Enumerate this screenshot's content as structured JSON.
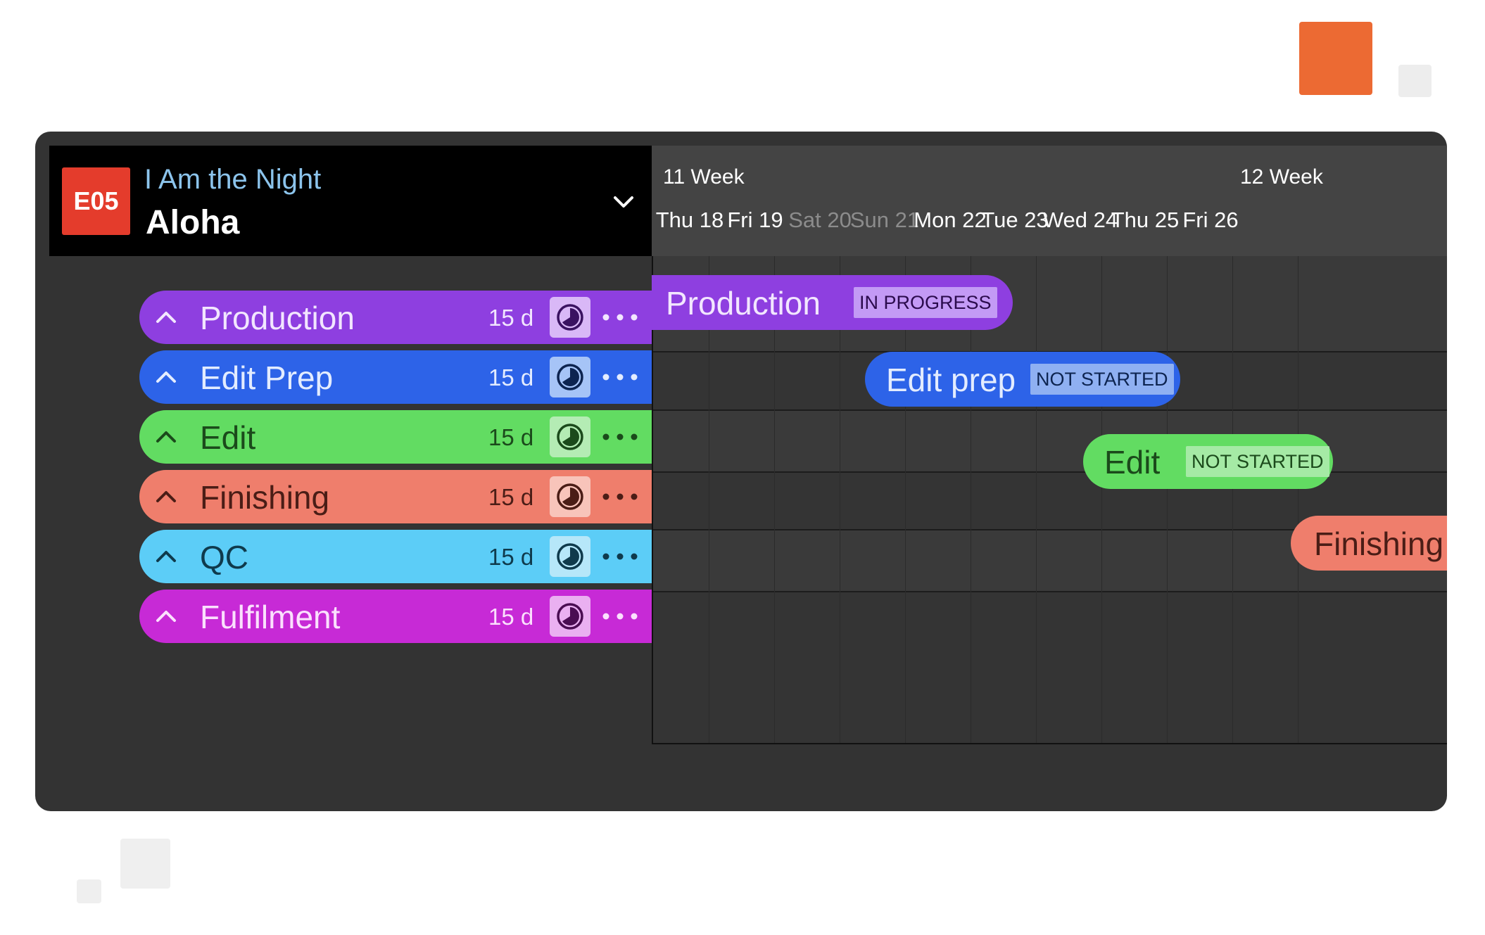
{
  "project": {
    "episode_code": "E05",
    "title": "I Am the Night",
    "episode_title": "Aloha"
  },
  "timeline": {
    "weeks": [
      {
        "label": "11 Week"
      },
      {
        "label": "12 Week"
      }
    ],
    "days": [
      {
        "label": "Thu 18",
        "weekend": false
      },
      {
        "label": "Fri 19",
        "weekend": false
      },
      {
        "label": "Sat 20",
        "weekend": true
      },
      {
        "label": "Sun 21",
        "weekend": true
      },
      {
        "label": "Mon 22",
        "weekend": false
      },
      {
        "label": "Tue 23",
        "weekend": false
      },
      {
        "label": "Wed 24",
        "weekend": false
      },
      {
        "label": "Thu 25",
        "weekend": false
      },
      {
        "label": "Fri 26",
        "weekend": false
      }
    ]
  },
  "phases": [
    {
      "name": "Production",
      "duration": "15 d",
      "color": "#8e3fe0",
      "text_color": "#f2e6ff",
      "clock_bg": "#d9b8f7",
      "clock_fg": "#3a1261"
    },
    {
      "name": "Edit Prep",
      "duration": "15 d",
      "color": "#2d63e8",
      "text_color": "#e3ecff",
      "clock_bg": "#a6c4f7",
      "clock_fg": "#0d2450"
    },
    {
      "name": "Edit",
      "duration": "15 d",
      "color": "#62dc62",
      "text_color": "#1b4a1b",
      "clock_bg": "#b4ecb4",
      "clock_fg": "#1b4a1b"
    },
    {
      "name": "Finishing",
      "duration": "15 d",
      "color": "#ef7e6c",
      "text_color": "#4a1d16",
      "clock_bg": "#f8c4ba",
      "clock_fg": "#4a1d16"
    },
    {
      "name": "QC",
      "duration": "15 d",
      "color": "#5ccdf7",
      "text_color": "#0f3a4c",
      "clock_bg": "#b6e7f9",
      "clock_fg": "#0f3a4c"
    },
    {
      "name": "Fulfilment",
      "duration": "15 d",
      "color": "#c72ad6",
      "text_color": "#fbe0fd",
      "clock_bg": "#eab0f1",
      "clock_fg": "#4a0d52"
    }
  ],
  "bars": [
    {
      "label": "Production",
      "status": "IN PROGRESS",
      "color": "#8e3fe0",
      "text_color": "#f2e6ff",
      "status_bg": "#c39af5",
      "status_fg": "#2b0b4d"
    },
    {
      "label": "Edit prep",
      "status": "NOT STARTED",
      "color": "#2d63e8",
      "text_color": "#e3ecff",
      "status_bg": "#8fb0f2",
      "status_fg": "#0d2450"
    },
    {
      "label": "Edit",
      "status": "NOT STARTED",
      "color": "#62dc62",
      "text_color": "#1b4a1b",
      "status_bg": "#a5eaa5",
      "status_fg": "#1b4a1b"
    },
    {
      "label": "Finishing",
      "status": "",
      "color": "#ef7e6c",
      "text_color": "#4a1d16",
      "status_bg": "",
      "status_fg": ""
    }
  ]
}
